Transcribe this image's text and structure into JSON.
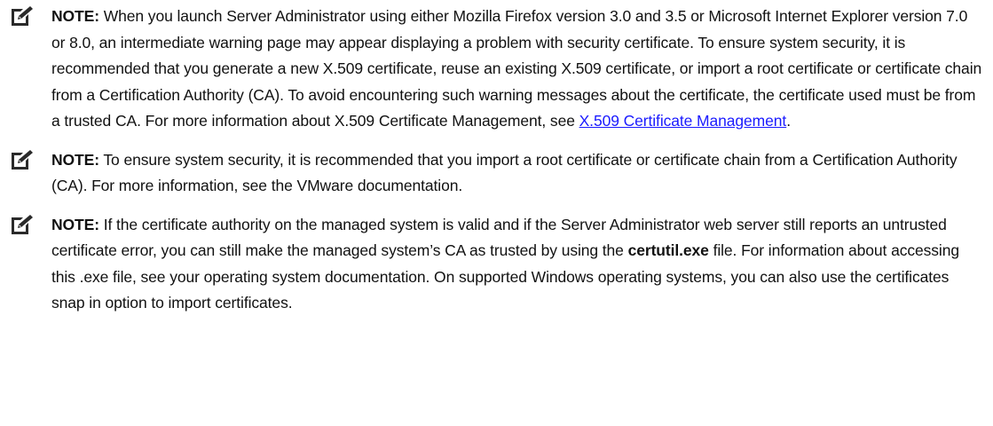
{
  "notes": [
    {
      "icon": "note-pencil-icon",
      "label": "NOTE:",
      "text_before_link": " When you launch Server Administrator using either Mozilla Firefox version 3.0 and 3.5 or Microsoft Internet Explorer version 7.0 or 8.0, an intermediate warning page may appear displaying a problem with security certificate. To ensure system security, it is recommended that you generate a new X.509 certificate, reuse an existing X.509 certificate, or import a root certificate or certificate chain from a Certification Authority (CA). To avoid encountering such warning messages about the certificate, the certificate used must be from a trusted CA. For more information about X.509 Certificate Management, see ",
      "link_text": "X.509 Certificate Management",
      "text_after_link": "."
    },
    {
      "icon": "note-pencil-icon",
      "label": "NOTE:",
      "text": " To ensure system security, it is recommended that you import a root certificate or certificate chain from a Certification Authority (CA). For more information, see the VMware documentation."
    },
    {
      "icon": "note-pencil-icon",
      "label": "NOTE:",
      "text_before_bold": " If the certificate authority on the managed system is valid and if the Server Administrator web server still reports an untrusted certificate error, you can still make the managed system’s CA as trusted by using the ",
      "bold_text": "certutil.exe",
      "text_after_bold": " file. For information about accessing this .exe file, see your operating system documentation. On supported Windows operating systems, you can also use the certificates snap in option to import certificates."
    }
  ],
  "colors": {
    "text": "#111111",
    "link": "#1a1aff",
    "icon": "#2a2a2a"
  }
}
